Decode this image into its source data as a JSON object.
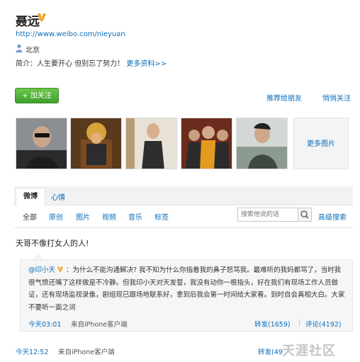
{
  "profile": {
    "name": "聂远",
    "url": "http://www.weibo.com/nieyuan",
    "location": "北京",
    "bio_prefix": "简介：人生要开心 但别忘了努力！",
    "more_info": "更多资料>>"
  },
  "actions": {
    "follow": "+ 加关注",
    "recommend": "推荐给朋友",
    "whisper": "悄悄关注"
  },
  "photos": {
    "more_label": "更多图片"
  },
  "tabs": {
    "weibo": "微博",
    "mood": "心情"
  },
  "filters": [
    "全部",
    "原创",
    "图片",
    "视频",
    "音乐",
    "标签"
  ],
  "search": {
    "placeholder": "搜索他说的话",
    "advanced": "高级搜索"
  },
  "post": {
    "text": "天哥不像打女人的人!",
    "quote": {
      "author": "@印小天",
      "text": "为什么不能沟通解决? 我不知为什么你指着我的鼻子怒骂我。最难听的我妈都骂了，当时我很气愤还嘴了这样做是不冷静。但我印小天对天发誓，我没有动你一根指头，好在我们有现场工作人员做证，还有现场监视录像，剧组现已跟场地联系好，拿到后我会第一时间给大家看。到时自会真相大白。大家不要听一面之词",
      "time": "今天03:01",
      "source": "来自iPhone客户端",
      "repost": "转发(1659)",
      "separator": "|",
      "comment": "评论(4192)"
    },
    "time": "今天12:52",
    "source": "来自iPhone客户端",
    "repost": "转发(49"
  },
  "watermark": "天涯社区",
  "colors": {
    "link": "#0a6cb8",
    "follow_button": "#4caf33",
    "verified_badge": "#f3a21b"
  }
}
